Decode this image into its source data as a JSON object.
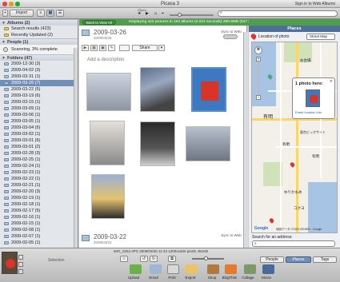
{
  "window": {
    "title": "Picasa 3",
    "signin": "Sign in to Web Albums"
  },
  "toolbar": {
    "import": "Import",
    "filters": "Filters"
  },
  "status_bar": {
    "back": "Back to View All",
    "displaying": "Displaying 423 pictures in 153 albums (0.021 seconds) 286.8MB (947 MPixel)"
  },
  "sidebar": {
    "albums_header": "Albums (2)",
    "albums": [
      "Search results (423)",
      "Recently Updated (2)"
    ],
    "people_header": "People (1)",
    "scanning": "Scanning, 3% complete",
    "folders_header": "Folders (47)",
    "folders": [
      "2009-12-30 (3)",
      "2009-04-02 (3)",
      "2009-03-31 (1)",
      "2009-03-26 (7)",
      "2009-03-22 (5)",
      "2009-03-19 (6)",
      "2009-03-15 (1)",
      "2009-03-09 (1)",
      "2009-03-06 (1)",
      "2009-03-05 (1)",
      "2009-03-04 (5)",
      "2009-03-02 (1)",
      "2009-03-01 (6)",
      "2009-03-01 (2)",
      "2009-02-28 (3)",
      "2009-02-25 (1)",
      "2009-02-24 (1)",
      "2009-02-23 (1)",
      "2009-02-22 (1)",
      "2009-02-21 (1)",
      "2009-02-20 (3)",
      "2009-02-19 (1)",
      "2009-02-18 (1)",
      "2009-02-17 (5)",
      "2009-02-16 (1)",
      "2009-02-15 (1)",
      "2009-02-08 (1)",
      "2009-02-07 (1)",
      "2009-02-05 (1)"
    ],
    "selected_folder_index": 3
  },
  "album": {
    "date": "2009-03-26",
    "sub": "2009/03/26",
    "description": "Add a description",
    "sync": "Sync to Web",
    "share": "Share",
    "next_date": "2009-03-22",
    "next_sub": "2009/03/22"
  },
  "places": {
    "header": "Places",
    "location_label": "Location of photo",
    "map_type": "Street Map",
    "popup_title": "1 photo here:",
    "popup_link": "Erase location info",
    "search_label": "Search for an address:",
    "map_labels": [
      "有明",
      "有明",
      "東京ビッグサイト",
      "ゆりかもめ",
      "有明",
      "お台場",
      "コクヨ"
    ],
    "copyright": "地図データ ©2009 ZENRIN - Google"
  },
  "bottom": {
    "selection": "Selection",
    "file_info": "IMG_0253.JPG    2009/03/26 11:43    1200x1600 pixels    451KB",
    "tabs": [
      "People",
      "Places",
      "Tags"
    ],
    "actions": [
      "Upload",
      "Email",
      "Print",
      "Export",
      "Shop",
      "BlogThis!",
      "Collage",
      "Movie"
    ]
  },
  "colors": {
    "accent_green": "#4e9e4e",
    "selection_blue": "#6f8fb8",
    "places_header": "#4e6f96"
  }
}
